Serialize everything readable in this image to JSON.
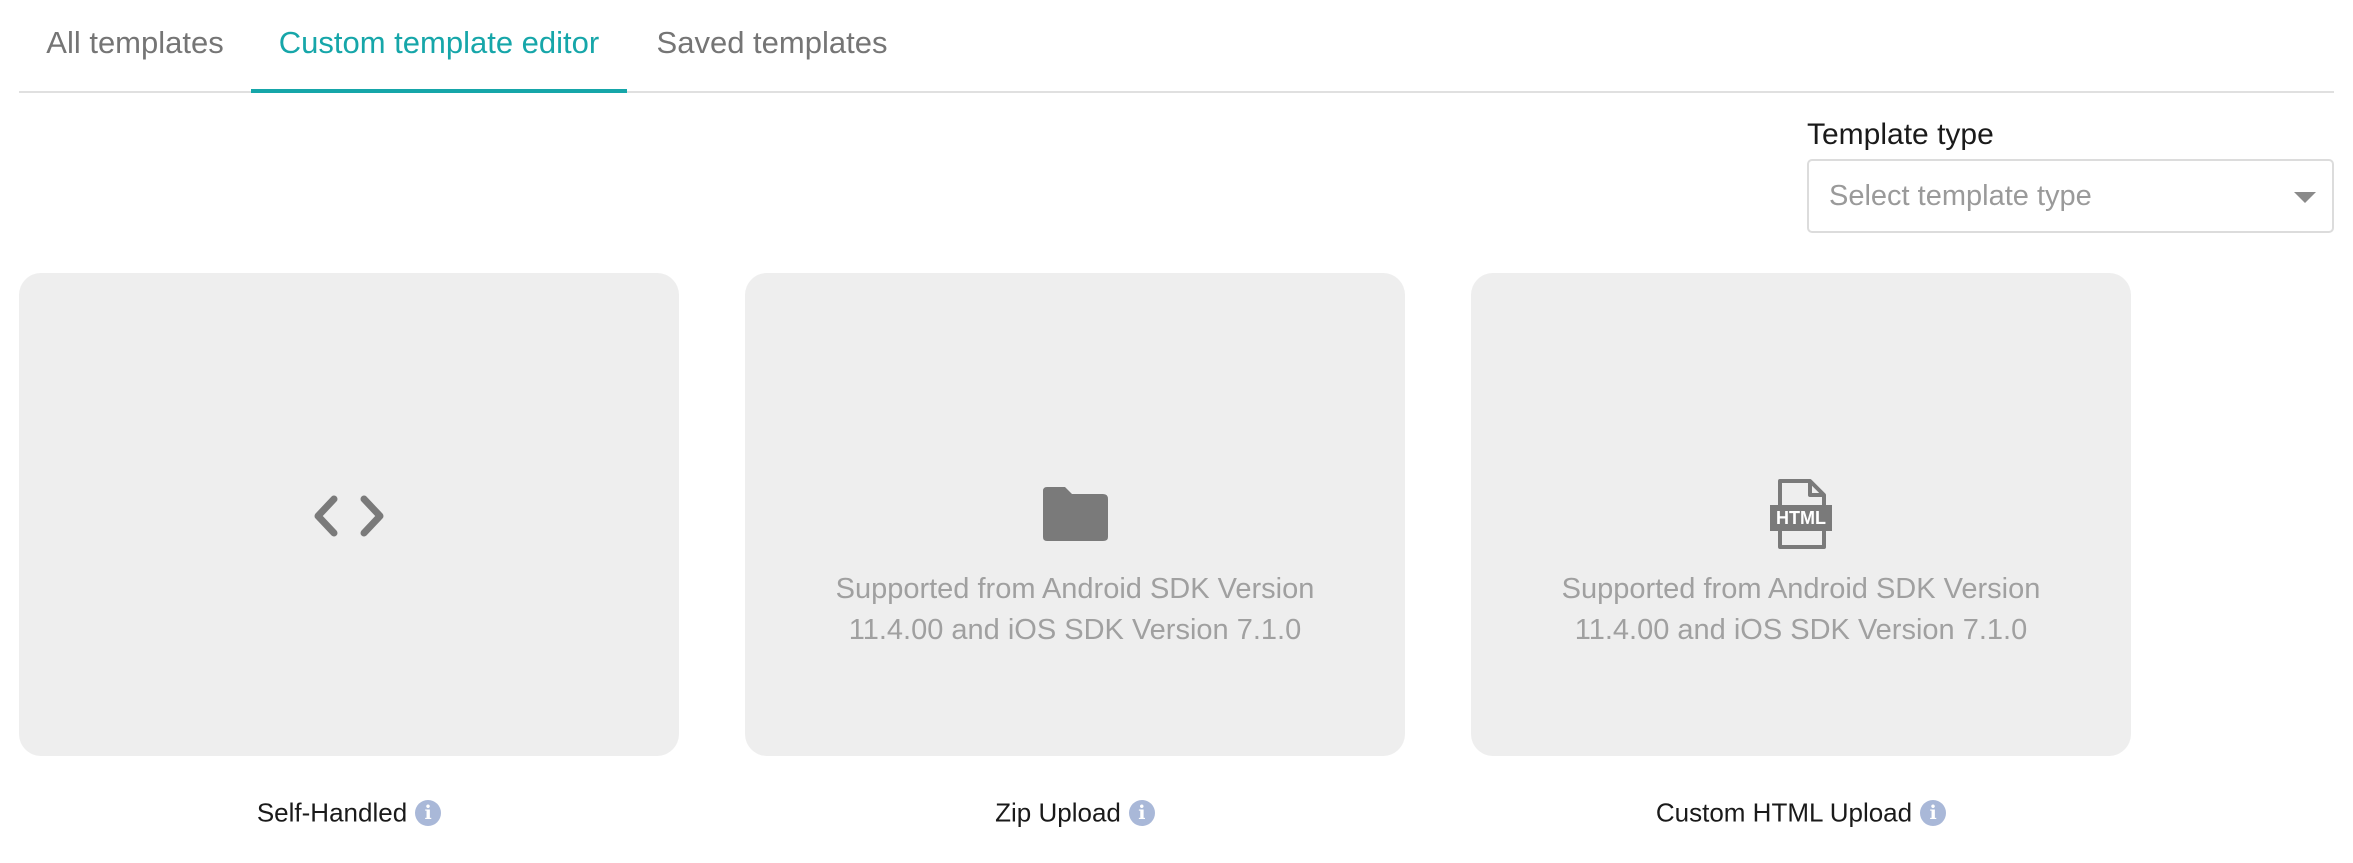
{
  "tabs": [
    {
      "label": "All templates",
      "active": false
    },
    {
      "label": "Custom template editor",
      "active": true
    },
    {
      "label": "Saved templates",
      "active": false
    }
  ],
  "template_type": {
    "label": "Template type",
    "placeholder": "Select template type"
  },
  "cards": [
    {
      "icon": "code-icon",
      "caption": "Self-Handled",
      "note_line1": "",
      "note_line2": ""
    },
    {
      "icon": "folder-icon",
      "caption": "Zip Upload",
      "note_line1": "Supported from Android SDK Version",
      "note_line2": "11.4.00 and iOS SDK Version 7.1.0"
    },
    {
      "icon": "html-file-icon",
      "caption": "Custom HTML Upload",
      "note_line1": "Supported from Android SDK Version",
      "note_line2": "11.4.00 and iOS SDK Version 7.1.0",
      "icon_text": "HTML"
    }
  ],
  "info_glyph": "i",
  "colors": {
    "accent": "#16a6a9",
    "card_bg": "#eeeeee",
    "icon": "#7a7a7a",
    "info_badge": "#a9b8d8"
  }
}
